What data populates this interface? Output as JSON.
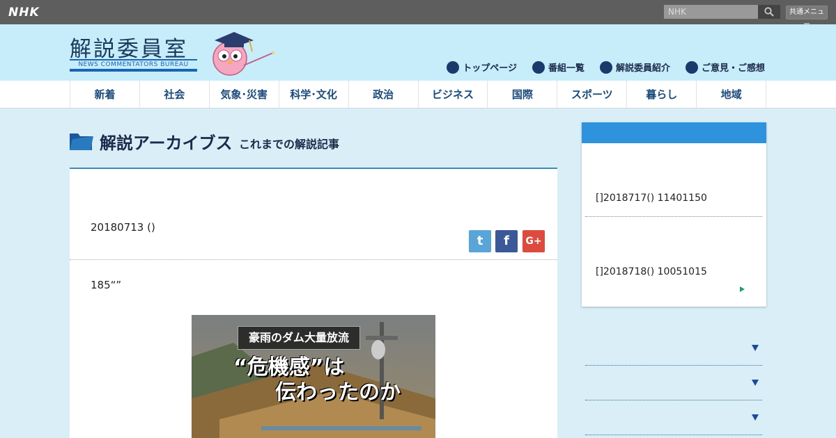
{
  "topbar": {
    "logo": "NHK",
    "search_placeholder": "NHK",
    "common_menu": "共通メニュー"
  },
  "header": {
    "title": "解説委員室",
    "subtitle": "NEWS COMMENTATORS BUREAU",
    "links": [
      {
        "label": "トップページ",
        "icon": "home-icon"
      },
      {
        "label": "番組一覧",
        "icon": "tv-icon"
      },
      {
        "label": "解説委員紹介",
        "icon": "person-icon"
      },
      {
        "label": "ご意見・ご感想",
        "icon": "mail-icon"
      }
    ]
  },
  "nav": {
    "items": [
      "新着",
      "社会",
      "気象･災害",
      "科学･文化",
      "政治",
      "ビジネス",
      "国際",
      "スポーツ",
      "暮らし",
      "地域"
    ]
  },
  "archive": {
    "title": "解説アーカイブス",
    "subtitle": "これまでの解説記事"
  },
  "article": {
    "date": "20180713 ()",
    "lead": "185“”",
    "share": {
      "twitter": "t",
      "facebook": "f",
      "google": "G+"
    },
    "image": {
      "caption1": "豪雨のダム大量放流",
      "caption2": "“危機感”は",
      "caption3": "伝わったのか"
    }
  },
  "sidebar": {
    "entries": [
      "[]2018717() 11401150",
      "[]2018718() 10051015"
    ],
    "accordion_count": 3
  },
  "colors": {
    "topbar": "#5e5e5e",
    "header": "#c7ecfa",
    "page_bg": "#d9eef6",
    "accent": "#2e93dc",
    "twitter": "#5aa5d8",
    "facebook": "#3b5998",
    "google": "#dc4b3e"
  }
}
